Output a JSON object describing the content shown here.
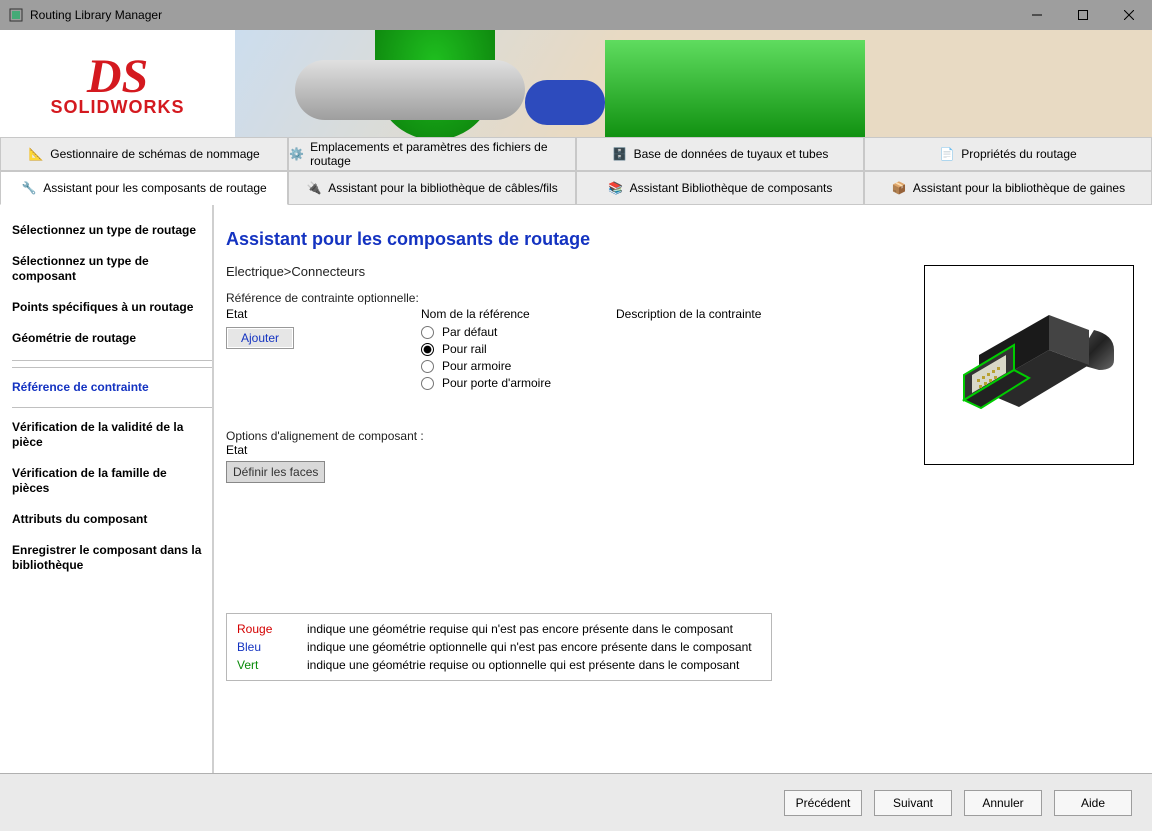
{
  "window": {
    "title": "Routing Library Manager"
  },
  "branding": {
    "logo_sub": "SOLIDWORKS"
  },
  "tabs_row1": [
    {
      "label": "Gestionnaire de schémas de nommage"
    },
    {
      "label": "Emplacements et paramètres des fichiers de routage"
    },
    {
      "label": "Base de données de tuyaux et tubes"
    },
    {
      "label": "Propriétés du routage"
    }
  ],
  "tabs_row2": [
    {
      "label": "Assistant pour les composants de routage",
      "active": true
    },
    {
      "label": "Assistant pour la bibliothèque de câbles/fils"
    },
    {
      "label": "Assistant Bibliothèque de composants"
    },
    {
      "label": "Assistant pour la bibliothèque de gaines"
    }
  ],
  "sidebar": {
    "items": [
      "Sélectionnez un type de routage",
      "Sélectionnez un type de composant",
      "Points spécifiques à un routage",
      "Géométrie de routage",
      "Référence de contrainte",
      "Vérification de la validité de la pièce",
      "Vérification de la famille de pièces",
      "Attributs du composant",
      "Enregistrer le composant dans la bibliothèque"
    ],
    "current_index": 4
  },
  "main": {
    "title": "Assistant pour les composants de routage",
    "breadcrumb": "Electrique>Connecteurs",
    "section1_title": "Référence de contrainte optionnelle:",
    "col_etat": "Etat",
    "col_ref": "Nom de la référence",
    "col_desc": "Description de la contrainte",
    "add_btn": "Ajouter",
    "radios": [
      {
        "label": "Par défaut",
        "checked": false
      },
      {
        "label": "Pour rail",
        "checked": true
      },
      {
        "label": "Pour armoire",
        "checked": false
      },
      {
        "label": "Pour porte d'armoire",
        "checked": false
      }
    ],
    "section2_title": "Options d'alignement de composant :",
    "section2_etat": "Etat",
    "define_faces_btn": "Définir les faces"
  },
  "legend": {
    "rows": [
      {
        "color": "Rouge",
        "cls": "red",
        "text": "indique une géométrie requise qui n'est pas encore présente dans le composant"
      },
      {
        "color": "Bleu",
        "cls": "blue",
        "text": "indique une géométrie optionnelle qui n'est pas encore présente dans le composant"
      },
      {
        "color": "Vert",
        "cls": "green",
        "text": "indique une géométrie requise ou optionnelle qui est présente dans le composant"
      }
    ]
  },
  "footer": {
    "prev": "Précédent",
    "next": "Suivant",
    "cancel": "Annuler",
    "help": "Aide"
  }
}
